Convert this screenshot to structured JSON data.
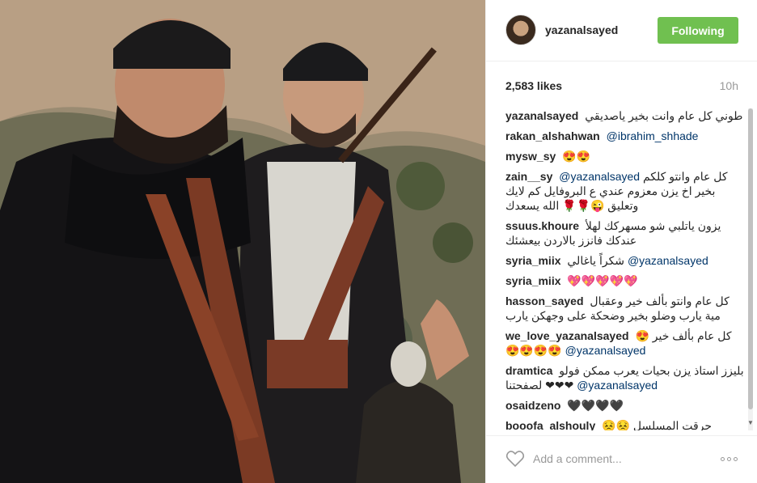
{
  "post": {
    "image_alt": "Two men in traditional dark clothing with ammunition belts standing on a hillside",
    "icons": {
      "like": "heart-outline-icon",
      "more": "more-options-icon"
    }
  },
  "header": {
    "username": "yazanalsayed",
    "follow_label": "Following",
    "follow_color": "#70c050"
  },
  "stats": {
    "likes": "2,583 likes",
    "time": "10h"
  },
  "comments": [
    {
      "user": "yazanalsayed",
      "text": "طوني كل عام وانت بخير ياصديقي",
      "mention": ""
    },
    {
      "user": "rakan_alshahwan",
      "text": "",
      "mention": "@ibrahim_shhade"
    },
    {
      "user": "mysw_sy",
      "text": "😍😍",
      "mention": ""
    },
    {
      "user": "zain__sy",
      "text": "كل عام وانتو كلكم بخير اخ يزن معزوم عندي ع البروفايل كم لايك وتعليق 😜🌹🌹 الله يسعدك",
      "mention": "@yazanalsayed"
    },
    {
      "user": "ssuus.khoure",
      "text": "يزون ياتلبي شو مسهركك لهلأ عندكك فانزز بالاردن بيعشئك",
      "mention": ""
    },
    {
      "user": "syria_miix",
      "text": "شكراً ياغالي",
      "mention": "@yazanalsayed"
    },
    {
      "user": "syria_miix",
      "text": "💖💖💖💖💖",
      "mention": ""
    },
    {
      "user": "hasson_sayed",
      "text": "كل عام وانتو بألف خير وعقبال مية يارب وضلو بخير وضحكة على وجهكن يارب",
      "mention": ""
    },
    {
      "user": "we_love_yazanalsayed",
      "text": "كل عام بألف خير 😍😍😍😍😍",
      "mention": "@yazanalsayed"
    },
    {
      "user": "dramtica",
      "text": "بليزز استاذ يزن بحيات يعرب ممكن فولو ❤❤❤ لصفحتنا",
      "mention": "@yazanalsayed"
    },
    {
      "user": "osaidzeno",
      "text": "🖤🖤🖤🖤",
      "mention": ""
    },
    {
      "user": "booofa_alshouly",
      "text": "حرقت المسلسل 😣😣",
      "mention": ""
    }
  ],
  "footer": {
    "placeholder": "Add a comment..."
  }
}
